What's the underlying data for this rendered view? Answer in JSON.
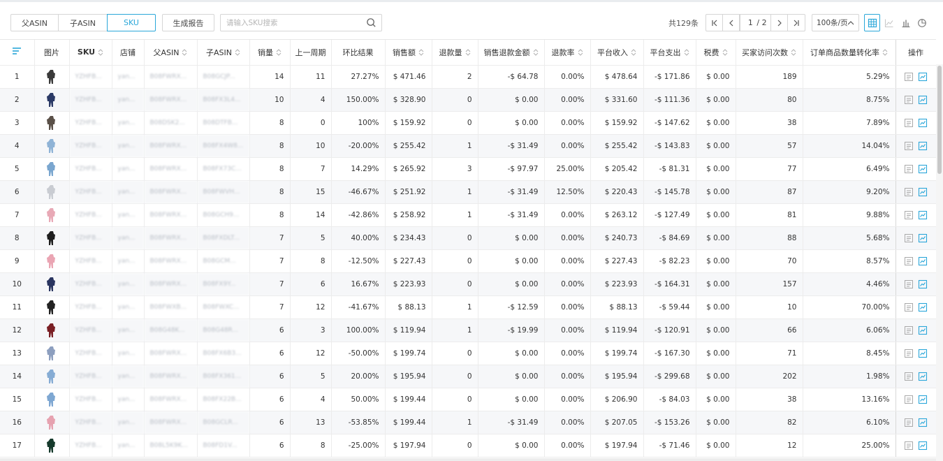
{
  "tabs": [
    {
      "label": "父ASIN",
      "active": false
    },
    {
      "label": "子ASIN",
      "active": false
    },
    {
      "label": "SKU",
      "active": true
    }
  ],
  "report_button": "生成报告",
  "search": {
    "placeholder": "请输入SKU搜索",
    "value": ""
  },
  "pagination": {
    "total": "共129条",
    "current": "1",
    "pages": "/ 2",
    "per_page": "100条/页"
  },
  "view_icons": [
    "table-view-icon",
    "line-chart-icon",
    "bar-chart-icon",
    "pie-chart-icon"
  ],
  "colors": {
    "accent": "#2aa7d9",
    "border": "#d6d6d6",
    "row_alt": "#f6f7f9"
  },
  "columns": {
    "image": "图片",
    "sku": "SKU",
    "store": "店铺",
    "parent_asin": "父ASIN",
    "child_asin": "子ASIN",
    "sales_qty": "销量",
    "prev_week": "上一周期",
    "change": "环比结果",
    "sales_amount": "销售额",
    "refund_qty": "退款量",
    "refund_amount": "销售退款金额",
    "refund_rate": "退款率",
    "platform_income": "平台收入",
    "platform_expense": "平台支出",
    "tax": "税费",
    "visits": "买家访问次数",
    "conversion": "订单商品数量转化率",
    "ops": "操作"
  },
  "rows": [
    {
      "idx": "1",
      "sku": "YZHFB...",
      "store": "yan...",
      "pasin": "B08FWRX...",
      "casin": "B08GCJP...",
      "qty": "14",
      "prev": "11",
      "chg": "27.27%",
      "sales": "$ 471.46",
      "rqty": "2",
      "ramt": "-$ 64.78",
      "rrate": "0.00%",
      "inc": "$ 478.64",
      "exp": "-$ 171.86",
      "tax": "$ 0.00",
      "visits": "189",
      "conv": "5.29%",
      "img": "#3a3a3a"
    },
    {
      "idx": "2",
      "sku": "YZHFB...",
      "store": "yan...",
      "pasin": "B08FWRX...",
      "casin": "B08FX3L4...",
      "qty": "10",
      "prev": "4",
      "chg": "150.00%",
      "sales": "$ 328.90",
      "rqty": "0",
      "ramt": "$ 0.00",
      "rrate": "0.00%",
      "inc": "$ 331.60",
      "exp": "-$ 111.36",
      "tax": "$ 0.00",
      "visits": "80",
      "conv": "8.75%",
      "img": "#2b3a66"
    },
    {
      "idx": "3",
      "sku": "YZHFB...",
      "store": "yan...",
      "pasin": "B08DSK2...",
      "casin": "B08DTFB...",
      "qty": "8",
      "prev": "0",
      "chg": "100%",
      "sales": "$ 159.92",
      "rqty": "0",
      "ramt": "$ 0.00",
      "rrate": "0.00%",
      "inc": "$ 159.92",
      "exp": "-$ 147.62",
      "tax": "$ 0.00",
      "visits": "38",
      "conv": "7.89%",
      "img": "#5a5048"
    },
    {
      "idx": "4",
      "sku": "YZHFB...",
      "store": "yan...",
      "pasin": "B08FWRX...",
      "casin": "B08FX4W8...",
      "qty": "8",
      "prev": "10",
      "chg": "-20.00%",
      "sales": "$ 255.42",
      "rqty": "1",
      "ramt": "-$ 31.49",
      "rrate": "0.00%",
      "inc": "$ 255.42",
      "exp": "-$ 143.83",
      "tax": "$ 0.00",
      "visits": "57",
      "conv": "14.04%",
      "img": "#8fb3d6"
    },
    {
      "idx": "5",
      "sku": "YZHFB...",
      "store": "yan...",
      "pasin": "B08FWRX...",
      "casin": "B08FX73C...",
      "qty": "8",
      "prev": "7",
      "chg": "14.29%",
      "sales": "$ 265.92",
      "rqty": "3",
      "ramt": "-$ 97.97",
      "rrate": "25.00%",
      "inc": "$ 205.42",
      "exp": "-$ 81.31",
      "tax": "$ 0.00",
      "visits": "77",
      "conv": "6.49%",
      "img": "#7aa6cf"
    },
    {
      "idx": "6",
      "sku": "YZHFB...",
      "store": "yan...",
      "pasin": "B08FWRX...",
      "casin": "B08FWVH...",
      "qty": "8",
      "prev": "15",
      "chg": "-46.67%",
      "sales": "$ 251.92",
      "rqty": "1",
      "ramt": "-$ 31.49",
      "rrate": "12.50%",
      "inc": "$ 220.43",
      "exp": "-$ 145.78",
      "tax": "$ 0.00",
      "visits": "87",
      "conv": "9.20%",
      "img": "#c9ccd2"
    },
    {
      "idx": "7",
      "sku": "YZHFB...",
      "store": "yan...",
      "pasin": "B08FWRX...",
      "casin": "B08GCH9...",
      "qty": "8",
      "prev": "14",
      "chg": "-42.86%",
      "sales": "$ 258.92",
      "rqty": "1",
      "ramt": "-$ 31.49",
      "rrate": "0.00%",
      "inc": "$ 263.12",
      "exp": "-$ 127.49",
      "tax": "$ 0.00",
      "visits": "81",
      "conv": "9.88%",
      "img": "#e8a9b6"
    },
    {
      "idx": "8",
      "sku": "YZHFB...",
      "store": "yan...",
      "pasin": "B08FWRX...",
      "casin": "B08FXDLT...",
      "qty": "7",
      "prev": "5",
      "chg": "40.00%",
      "sales": "$ 234.43",
      "rqty": "0",
      "ramt": "$ 0.00",
      "rrate": "0.00%",
      "inc": "$ 240.73",
      "exp": "-$ 84.69",
      "tax": "$ 0.00",
      "visits": "88",
      "conv": "5.68%",
      "img": "#1e1e1e"
    },
    {
      "idx": "9",
      "sku": "YZHFB...",
      "store": "yan...",
      "pasin": "B08FWRX...",
      "casin": "B08GCM...",
      "qty": "7",
      "prev": "8",
      "chg": "-12.50%",
      "sales": "$ 227.43",
      "rqty": "0",
      "ramt": "$ 0.00",
      "rrate": "0.00%",
      "inc": "$ 227.43",
      "exp": "-$ 82.23",
      "tax": "$ 0.00",
      "visits": "70",
      "conv": "8.57%",
      "img": "#eaa5b3"
    },
    {
      "idx": "10",
      "sku": "YZHFB...",
      "store": "yan...",
      "pasin": "B08FWRX...",
      "casin": "B08FX9Y...",
      "qty": "7",
      "prev": "6",
      "chg": "16.67%",
      "sales": "$ 223.93",
      "rqty": "0",
      "ramt": "$ 0.00",
      "rrate": "0.00%",
      "inc": "$ 223.93",
      "exp": "-$ 164.31",
      "tax": "$ 0.00",
      "visits": "157",
      "conv": "4.46%",
      "img": "#2a3560"
    },
    {
      "idx": "11",
      "sku": "YZHFB...",
      "store": "yan...",
      "pasin": "B08FWXB...",
      "casin": "B08FWXC...",
      "qty": "7",
      "prev": "12",
      "chg": "-41.67%",
      "sales": "$ 88.13",
      "rqty": "1",
      "ramt": "-$ 12.59",
      "rrate": "0.00%",
      "inc": "$ 88.13",
      "exp": "-$ 59.44",
      "tax": "$ 0.00",
      "visits": "10",
      "conv": "70.00%",
      "img": "#222222"
    },
    {
      "idx": "12",
      "sku": "YZHFB...",
      "store": "yan...",
      "pasin": "B08G48K...",
      "casin": "B08G48R...",
      "qty": "6",
      "prev": "3",
      "chg": "100.00%",
      "sales": "$ 119.94",
      "rqty": "1",
      "ramt": "-$ 19.99",
      "rrate": "0.00%",
      "inc": "$ 119.94",
      "exp": "-$ 120.91",
      "tax": "$ 0.00",
      "visits": "66",
      "conv": "6.06%",
      "img": "#7a1f24"
    },
    {
      "idx": "13",
      "sku": "YZHFB...",
      "store": "yan...",
      "pasin": "B08FWRX...",
      "casin": "B08FX6B3...",
      "qty": "6",
      "prev": "12",
      "chg": "-50.00%",
      "sales": "$ 199.74",
      "rqty": "0",
      "ramt": "$ 0.00",
      "rrate": "0.00%",
      "inc": "$ 199.74",
      "exp": "-$ 167.30",
      "tax": "$ 0.00",
      "visits": "71",
      "conv": "8.45%",
      "img": "#8d9fbf"
    },
    {
      "idx": "14",
      "sku": "YZHFB...",
      "store": "yan...",
      "pasin": "B08FWRX...",
      "casin": "B08FX361...",
      "qty": "6",
      "prev": "5",
      "chg": "20.00%",
      "sales": "$ 195.94",
      "rqty": "0",
      "ramt": "$ 0.00",
      "rrate": "0.00%",
      "inc": "$ 195.94",
      "exp": "-$ 299.68",
      "tax": "$ 0.00",
      "visits": "202",
      "conv": "1.98%",
      "img": "#86acd4"
    },
    {
      "idx": "15",
      "sku": "YZHFB...",
      "store": "yan...",
      "pasin": "B08FWRX...",
      "casin": "B08FX22B...",
      "qty": "6",
      "prev": "4",
      "chg": "50.00%",
      "sales": "$ 199.44",
      "rqty": "0",
      "ramt": "$ 0.00",
      "rrate": "0.00%",
      "inc": "$ 206.90",
      "exp": "-$ 84.03",
      "tax": "$ 0.00",
      "visits": "38",
      "conv": "13.16%",
      "img": "#7ea7d2"
    },
    {
      "idx": "16",
      "sku": "YZHFB...",
      "store": "yan...",
      "pasin": "B08FWRX...",
      "casin": "B08GCLR...",
      "qty": "6",
      "prev": "13",
      "chg": "-53.85%",
      "sales": "$ 199.44",
      "rqty": "1",
      "ramt": "-$ 31.49",
      "rrate": "0.00%",
      "inc": "$ 207.05",
      "exp": "-$ 153.26",
      "tax": "$ 0.00",
      "visits": "82",
      "conv": "6.10%",
      "img": "#e6a2b0"
    },
    {
      "idx": "17",
      "sku": "YZHFB...",
      "store": "yan...",
      "pasin": "B08L5K9K...",
      "casin": "B08FD1V...",
      "qty": "6",
      "prev": "8",
      "chg": "-25.00%",
      "sales": "$ 197.94",
      "rqty": "0",
      "ramt": "$ 0.00",
      "rrate": "0.00%",
      "inc": "$ 197.94",
      "exp": "-$ 71.46",
      "tax": "$ 0.00",
      "visits": "12",
      "conv": "25.00%",
      "img": "#163a2c"
    }
  ]
}
